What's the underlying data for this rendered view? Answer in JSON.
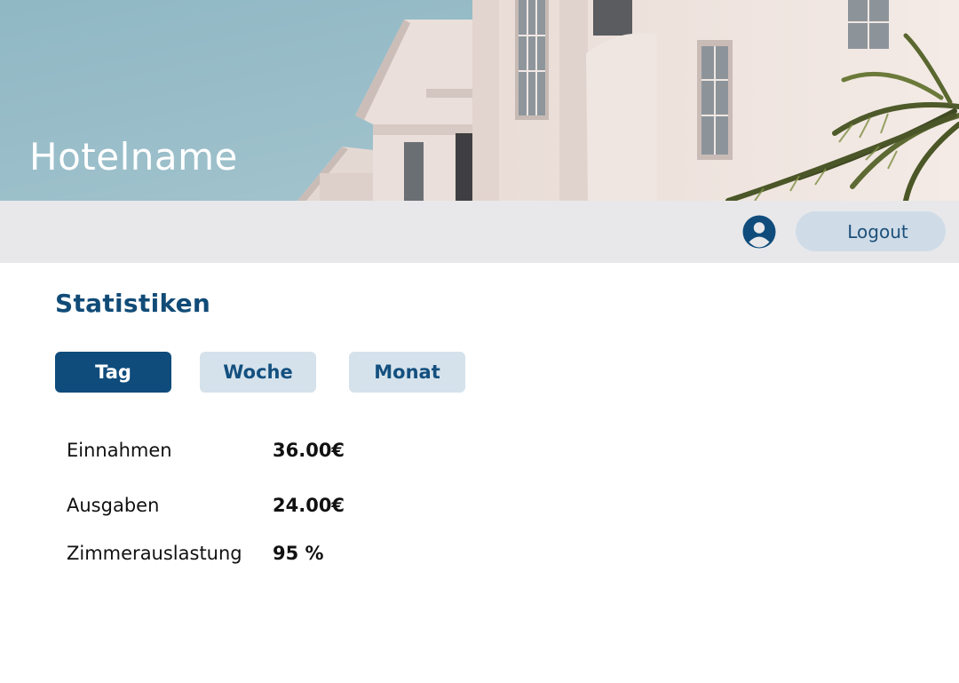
{
  "header": {
    "hotel_name": "Hotelname"
  },
  "topbar": {
    "avatar_icon": "user-circle-icon",
    "logout_label": "Logout"
  },
  "main": {
    "title": "Statistiken",
    "tabs": [
      {
        "label": "Tag",
        "active": true
      },
      {
        "label": "Woche",
        "active": false
      },
      {
        "label": "Monat",
        "active": false
      }
    ],
    "stats": [
      {
        "label": "Einnahmen",
        "value": "36.00€"
      },
      {
        "label": "Ausgaben",
        "value": "24.00€"
      },
      {
        "label": "Zimmerauslastung",
        "value": "95 %"
      }
    ]
  },
  "colors": {
    "brand_primary": "#0f4c7c",
    "tab_inactive": "#d5e2ec",
    "logout_bg": "#cfdce8",
    "topbar_bg": "#e8e8ea",
    "sky": "#9cbec9"
  }
}
